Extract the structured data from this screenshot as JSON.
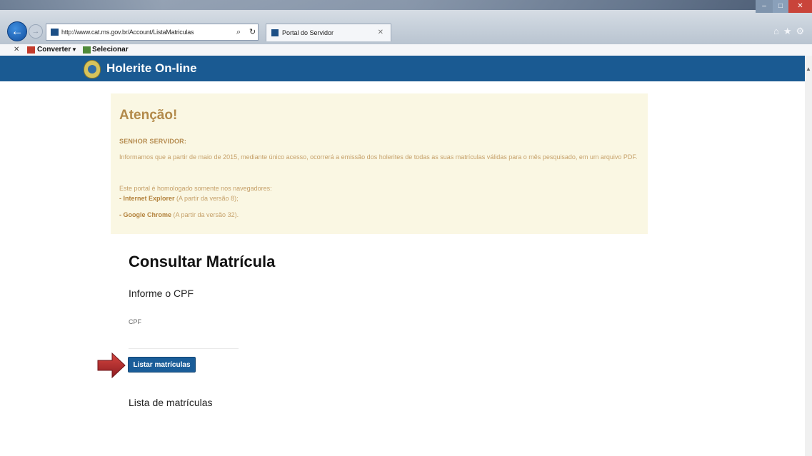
{
  "browser": {
    "url": "http://www.cat.ms.gov.br/Account/ListaMatriculas",
    "tab_title": "Portal do Servidor",
    "toolbar": {
      "converter_label": "Converter",
      "selecionar_label": "Selecionar"
    }
  },
  "site": {
    "title": "Holerite On-line"
  },
  "alert": {
    "title": "Atenção!",
    "subtitle": "SENHOR SERVIDOR:",
    "paragraph1": "Informamos que a partir de maio de 2015, mediante único acesso, ocorrerá a emissão dos holerites de todas as suas matrículas válidas para o mês pesquisado, em um arquivo PDF.",
    "paragraph2": "Este portal é homologado somente nos navegadores:",
    "browser1_name": "- Internet Explorer",
    "browser1_note": "(A partir da versão 8);",
    "browser2_name": "- Google Chrome",
    "browser2_note": "(A partir da versão 32)."
  },
  "main": {
    "title": "Consultar Matrícula",
    "subtitle": "Informe o CPF",
    "cpf_label": "CPF",
    "cpf_value": "",
    "button_label": "Listar matrículas",
    "list_heading": "Lista de matrículas"
  },
  "colors": {
    "header_blue": "#1a5a92",
    "alert_bg": "#faf7e3",
    "alert_text": "#c6a16a",
    "button_blue": "#1a5d99",
    "arrow_red": "#b3262a"
  }
}
